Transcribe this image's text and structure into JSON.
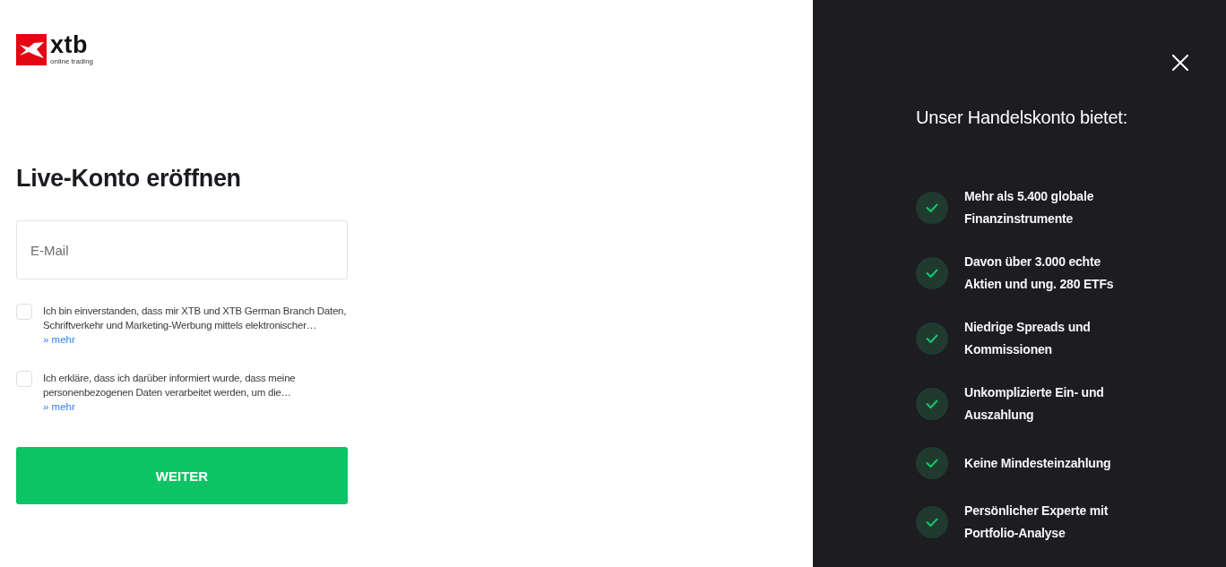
{
  "logo": {
    "wordmark": "xtb",
    "tagline": "online trading"
  },
  "form": {
    "title": "Live-Konto eröffnen",
    "email": {
      "placeholder": "E-Mail"
    },
    "consents": [
      {
        "text": "Ich bin einverstanden, dass mir XTB und XTB German Branch Daten, Schriftverkehr und Marketing-Werbung mittels elektronischer…",
        "checked": false,
        "more_link": "» mehr"
      },
      {
        "text": "Ich erkläre, dass ich darüber informiert wurde, dass meine personenbezogenen Daten verarbeitet werden, um die…",
        "checked": false,
        "more_link": "» mehr"
      }
    ],
    "submit": "WEITER"
  },
  "panel": {
    "title": "Unser Handelskonto bietet:",
    "benefits": [
      {
        "text": "Mehr als 5.400 globale Finanzinstrumente"
      },
      {
        "text": "Davon über 3.000 echte Aktien und ung. 280 ETFs"
      },
      {
        "text": "Niedrige Spreads und Kommissionen"
      },
      {
        "text": "Unkomplizierte Ein- und Auszahlung"
      },
      {
        "text": "Keine Mindesteinzahlung"
      },
      {
        "text": "Persönlicher Experte mit Portfolio-Analyse"
      }
    ]
  }
}
